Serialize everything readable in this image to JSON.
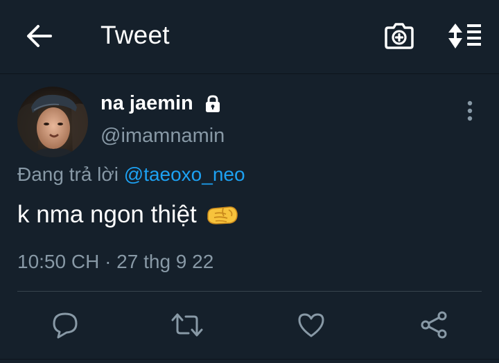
{
  "header": {
    "title": "Tweet",
    "back_icon": "arrow-left-icon",
    "camera_icon": "camera-plus-icon",
    "sort_icon": "sort-list-icon"
  },
  "tweet": {
    "display_name": "na jaemin",
    "protected_icon": "lock-icon",
    "handle": "@imamnamin",
    "reply_prefix": "Đang trả lời",
    "reply_to": "@taeoxo_neo",
    "text": "k nma ngon thiệt",
    "emoji_icon": "left-facing-fist-emoji",
    "timestamp": "10:50 CH · 27 thg 9 22"
  },
  "actions": [
    {
      "name": "reply",
      "icon": "comment-icon"
    },
    {
      "name": "retweet",
      "icon": "retweet-icon"
    },
    {
      "name": "like",
      "icon": "heart-icon"
    },
    {
      "name": "share",
      "icon": "share-icon"
    }
  ],
  "colors": {
    "background": "#15202b",
    "text_primary": "#ffffff",
    "text_secondary": "#8899a6",
    "link": "#1da1f2",
    "divider": "#38444d"
  }
}
